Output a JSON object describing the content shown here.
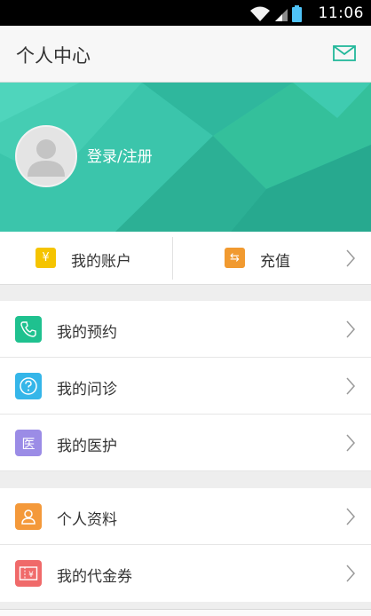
{
  "status_bar": {
    "time": "11:06"
  },
  "header": {
    "title": "个人中心",
    "mail_icon": "mail-icon"
  },
  "profile": {
    "login_label": "登录/注册",
    "avatar_icon": "avatar-placeholder-icon"
  },
  "account": {
    "my_account": {
      "label": "我的账户",
      "icon_glyph": "¥",
      "icon_color": "#f5c400"
    },
    "recharge": {
      "label": "充值",
      "icon_glyph": "⇆",
      "icon_color": "#f19a30"
    }
  },
  "menu_group_1": [
    {
      "label": "我的预约",
      "icon": "phone-icon",
      "color": "#1fc18f"
    },
    {
      "label": "我的问诊",
      "icon": "question-icon",
      "color": "#35b6e9"
    },
    {
      "label": "我的医护",
      "icon": "hospital-icon",
      "glyph": "医",
      "color": "#9b8ce6"
    }
  ],
  "menu_group_2": [
    {
      "label": "个人资料",
      "icon": "person-icon",
      "color": "#f4993a"
    },
    {
      "label": "我的代金券",
      "icon": "voucher-icon",
      "color": "#f06a6a"
    }
  ],
  "colors": {
    "banner_start": "#38c4a4",
    "banner_end": "#2ab4a0",
    "accent": "#22b89a"
  }
}
